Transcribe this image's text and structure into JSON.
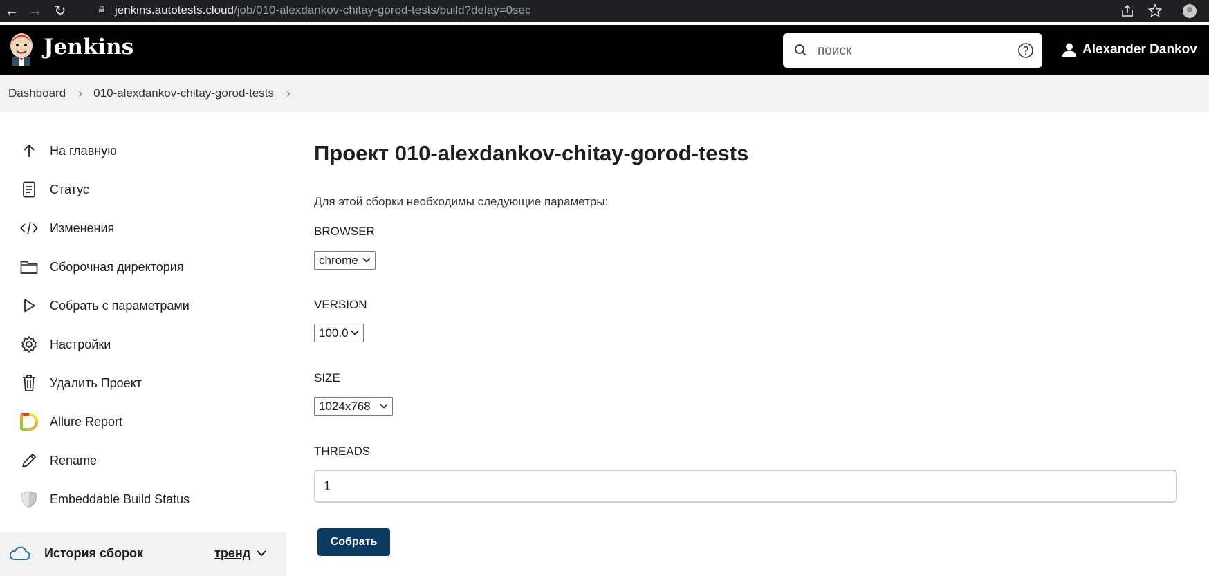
{
  "browser": {
    "url_host": "jenkins.autotests.cloud",
    "url_path": "/job/010-alexdankov-chitay-gorod-tests/build?delay=0sec"
  },
  "header": {
    "brand": "Jenkins",
    "search_placeholder": "поиск",
    "user_name": "Alexander Dankov"
  },
  "breadcrumbs": [
    "Dashboard",
    "010-alexdankov-chitay-gorod-tests"
  ],
  "sidebar": {
    "items": [
      {
        "label": "На главную",
        "icon": "arrow-up-icon"
      },
      {
        "label": "Статус",
        "icon": "document-icon"
      },
      {
        "label": "Изменения",
        "icon": "code-icon"
      },
      {
        "label": "Сборочная директория",
        "icon": "folder-icon"
      },
      {
        "label": "Собрать с параметрами",
        "icon": "play-icon"
      },
      {
        "label": "Настройки",
        "icon": "gear-icon"
      },
      {
        "label": "Удалить Проект",
        "icon": "trash-icon"
      },
      {
        "label": "Allure Report",
        "icon": "allure-icon"
      },
      {
        "label": "Rename",
        "icon": "pencil-icon"
      },
      {
        "label": "Embeddable Build Status",
        "icon": "shield-icon"
      }
    ],
    "history": {
      "label": "История сборок",
      "trend": "тренд"
    }
  },
  "main": {
    "title": "Проект 010-alexdankov-chitay-gorod-tests",
    "intro": "Для этой сборки необходимы следующие параметры:",
    "params": [
      {
        "label": "BROWSER",
        "value": "chrome"
      },
      {
        "label": "VERSION",
        "value": "100.0"
      },
      {
        "label": "SIZE",
        "value": "1024x768"
      },
      {
        "label": "THREADS",
        "value": "1"
      }
    ],
    "build_button": "Собрать"
  },
  "colors": {
    "header_bg": "#000000",
    "button_bg": "#0b3b63",
    "breadcrumb_bg": "#f2f2f2"
  }
}
